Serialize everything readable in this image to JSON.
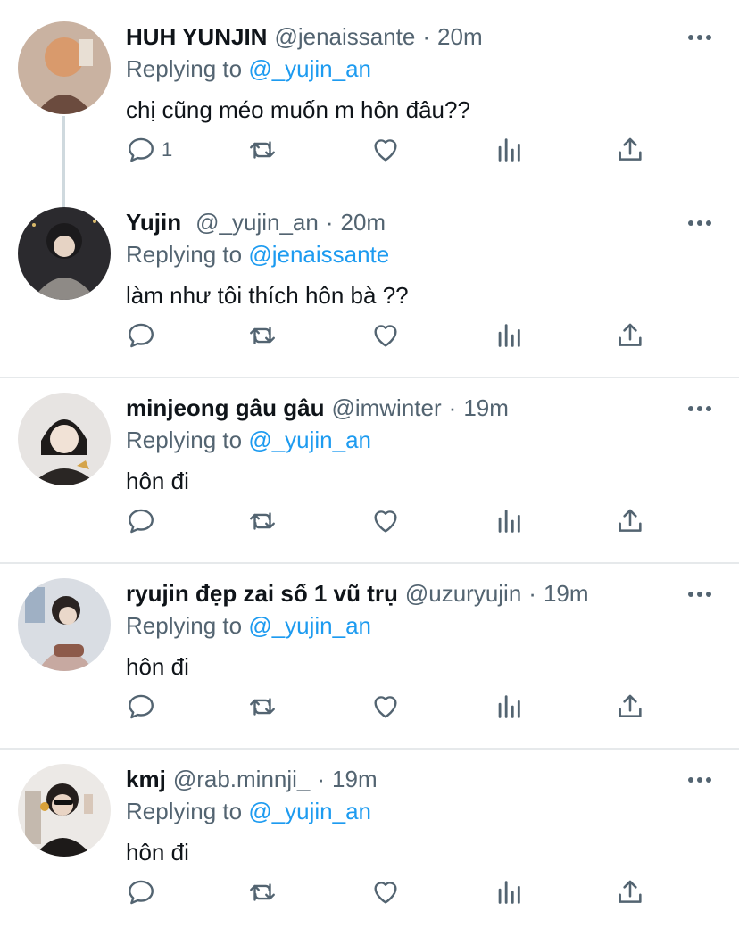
{
  "tweets": [
    {
      "name": "HUH YUNJIN",
      "handle": "@jenaissante",
      "separator": "·",
      "time": "20m",
      "reply_prefix": "Replying to",
      "reply_to": "@_yujin_an",
      "text": "chị cũng méo muốn m hôn đâu??",
      "reply_count": "1"
    },
    {
      "name": "Yujin",
      "handle": "@_yujin_an",
      "separator": "·",
      "time": "20m",
      "reply_prefix": "Replying to",
      "reply_to": "@jenaissante",
      "text": "làm như tôi thích hôn bà ??",
      "reply_count": ""
    },
    {
      "name": "minjeong gâu gâu",
      "handle": "@imwinter",
      "separator": "·",
      "time": "19m",
      "reply_prefix": "Replying to",
      "reply_to": "@_yujin_an",
      "text": "hôn đi",
      "reply_count": ""
    },
    {
      "name": "ryujin đẹp zai số 1 vũ trụ",
      "handle": "@uzuryujin",
      "separator": "·",
      "time": "19m",
      "reply_prefix": "Replying to",
      "reply_to": "@_yujin_an",
      "text": "hôn đi",
      "reply_count": ""
    },
    {
      "name": "kmj",
      "handle": "@rab.minnji_",
      "separator": "·",
      "time": "19m",
      "reply_prefix": "Replying to",
      "reply_to": "@_yujin_an",
      "text": "hôn đi",
      "reply_count": ""
    }
  ],
  "colors": {
    "link": "#1d9bf0",
    "secondary_text": "#536471",
    "icon": "#536471",
    "divider": "#e6e9eb"
  },
  "icons": {
    "more": "more-dots-icon",
    "reply": "reply-bubble-icon",
    "retweet": "retweet-icon",
    "like": "heart-icon",
    "views": "analytics-icon",
    "share": "share-icon"
  }
}
